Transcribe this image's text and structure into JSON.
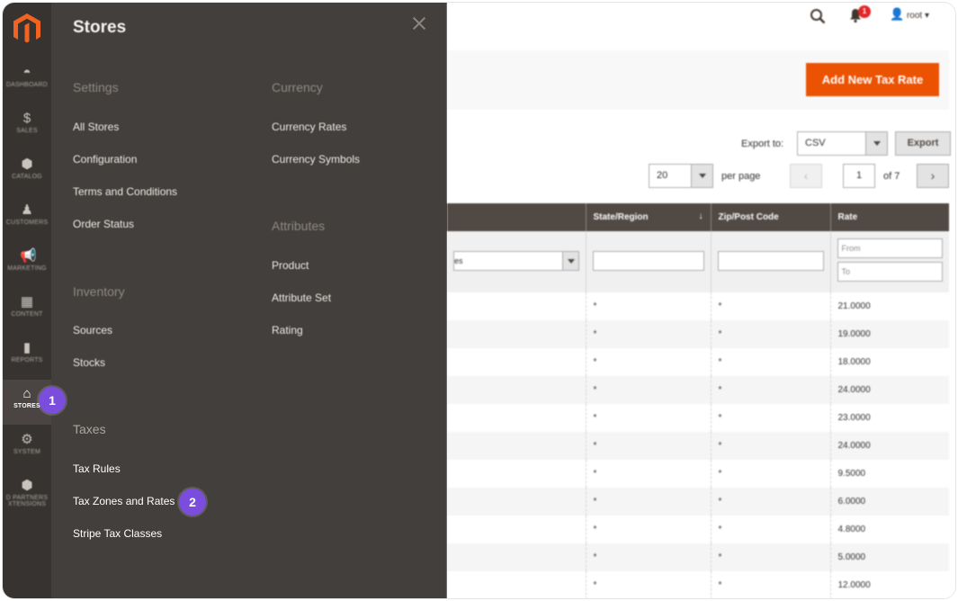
{
  "nav": {
    "items": [
      {
        "key": "dashboard",
        "label": "DASHBOARD",
        "icon": "dashboard-icon",
        "glyph": "◓"
      },
      {
        "key": "sales",
        "label": "SALES",
        "icon": "dollar-icon",
        "glyph": "$"
      },
      {
        "key": "catalog",
        "label": "CATALOG",
        "icon": "cube-icon",
        "glyph": "⬢"
      },
      {
        "key": "customers",
        "label": "CUSTOMERS",
        "icon": "person-icon",
        "glyph": "♟"
      },
      {
        "key": "marketing",
        "label": "MARKETING",
        "icon": "megaphone-icon",
        "glyph": "📢"
      },
      {
        "key": "content",
        "label": "CONTENT",
        "icon": "layout-icon",
        "glyph": "▦"
      },
      {
        "key": "reports",
        "label": "REPORTS",
        "icon": "bar-chart-icon",
        "glyph": "▮"
      },
      {
        "key": "stores",
        "label": "STORES",
        "icon": "storefront-icon",
        "glyph": "⌂"
      },
      {
        "key": "system",
        "label": "SYSTEM",
        "icon": "gear-icon",
        "glyph": "⚙"
      },
      {
        "key": "partners",
        "label": "D PARTNERS",
        "label2": "XTENSIONS",
        "icon": "box-icon",
        "glyph": "⬢"
      }
    ]
  },
  "flyout": {
    "title": "Stores",
    "sections": {
      "settings": {
        "heading": "Settings",
        "links": [
          "All Stores",
          "Configuration",
          "Terms and Conditions",
          "Order Status"
        ]
      },
      "inventory": {
        "heading": "Inventory",
        "links": [
          "Sources",
          "Stocks"
        ]
      },
      "taxes": {
        "heading": "Taxes",
        "links": [
          "Tax Rules",
          "Tax Zones and Rates",
          "Stripe Tax Classes"
        ]
      },
      "currency": {
        "heading": "Currency",
        "links": [
          "Currency Rates",
          "Currency Symbols"
        ]
      },
      "attributes": {
        "heading": "Attributes",
        "links": [
          "Product",
          "Attribute Set",
          "Rating"
        ]
      }
    }
  },
  "callouts": {
    "one": "1",
    "two": "2"
  },
  "page": {
    "header": {
      "bell_count": "1",
      "user": "root ▾"
    },
    "add_button": "Add New Tax Rate",
    "export": {
      "label": "Export to:",
      "value": "CSV",
      "button": "Export"
    },
    "pager": {
      "per_page_value": "20",
      "per_page_label": "per page",
      "prev": "‹",
      "page": "1",
      "of": "of 7",
      "next": "›"
    },
    "columns": [
      "",
      "State/Region",
      "Zip/Post Code",
      "Rate"
    ],
    "sort_arrow": "↓",
    "filters": {
      "select_partial": "es",
      "rate_from": "From",
      "rate_to": "To"
    },
    "rows": [
      {
        "state": "*",
        "zip": "*",
        "rate": "21.0000"
      },
      {
        "state": "*",
        "zip": "*",
        "rate": "19.0000"
      },
      {
        "state": "*",
        "zip": "*",
        "rate": "18.0000"
      },
      {
        "state": "*",
        "zip": "*",
        "rate": "24.0000"
      },
      {
        "state": "*",
        "zip": "*",
        "rate": "23.0000"
      },
      {
        "state": "*",
        "zip": "*",
        "rate": "24.0000"
      },
      {
        "state": "*",
        "zip": "*",
        "rate": "9.5000"
      },
      {
        "state": "*",
        "zip": "*",
        "rate": "6.0000"
      },
      {
        "state": "*",
        "zip": "*",
        "rate": "4.8000"
      },
      {
        "state": "*",
        "zip": "*",
        "rate": "5.0000"
      },
      {
        "state": "*",
        "zip": "*",
        "rate": "12.0000"
      }
    ]
  },
  "colors": {
    "brand_orange": "#eb5202",
    "nav_bg": "#373330",
    "flyout_bg": "#433f3c",
    "callout": "#7b4ddc",
    "grid_header": "#514943"
  }
}
